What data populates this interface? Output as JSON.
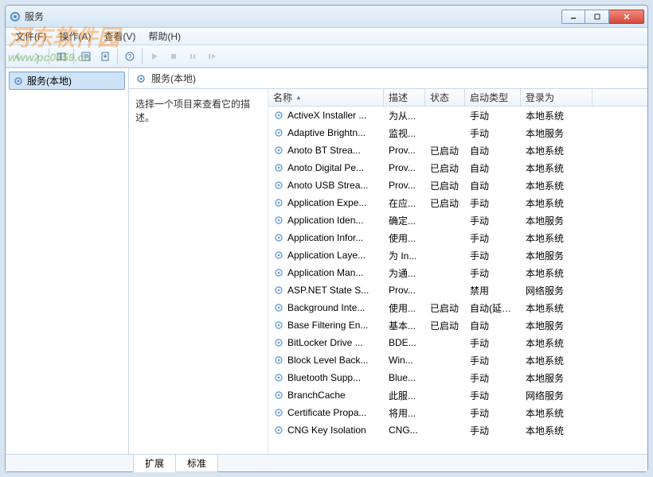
{
  "window": {
    "title": "服务"
  },
  "menubar": [
    {
      "label": "文件(F)"
    },
    {
      "label": "操作(A)"
    },
    {
      "label": "查看(V)"
    },
    {
      "label": "帮助(H)"
    }
  ],
  "tree": {
    "root": "服务(本地)"
  },
  "main_header": "服务(本地)",
  "desc_prompt": "选择一个项目来查看它的描述。",
  "columns": {
    "name": "名称",
    "desc": "描述",
    "status": "状态",
    "startup": "启动类型",
    "logon": "登录为"
  },
  "services": [
    {
      "name": "ActiveX Installer ...",
      "desc": "为从...",
      "status": "",
      "startup": "手动",
      "logon": "本地系统"
    },
    {
      "name": "Adaptive Brightn...",
      "desc": "监视...",
      "status": "",
      "startup": "手动",
      "logon": "本地服务"
    },
    {
      "name": "Anoto BT Strea...",
      "desc": "Prov...",
      "status": "已启动",
      "startup": "自动",
      "logon": "本地系统"
    },
    {
      "name": "Anoto Digital Pe...",
      "desc": "Prov...",
      "status": "已启动",
      "startup": "自动",
      "logon": "本地系统"
    },
    {
      "name": "Anoto USB Strea...",
      "desc": "Prov...",
      "status": "已启动",
      "startup": "自动",
      "logon": "本地系统"
    },
    {
      "name": "Application Expe...",
      "desc": "在应...",
      "status": "已启动",
      "startup": "手动",
      "logon": "本地系统"
    },
    {
      "name": "Application Iden...",
      "desc": "确定...",
      "status": "",
      "startup": "手动",
      "logon": "本地服务"
    },
    {
      "name": "Application Infor...",
      "desc": "使用...",
      "status": "",
      "startup": "手动",
      "logon": "本地系统"
    },
    {
      "name": "Application Laye...",
      "desc": "为 In...",
      "status": "",
      "startup": "手动",
      "logon": "本地服务"
    },
    {
      "name": "Application Man...",
      "desc": "为通...",
      "status": "",
      "startup": "手动",
      "logon": "本地系统"
    },
    {
      "name": "ASP.NET State S...",
      "desc": "Prov...",
      "status": "",
      "startup": "禁用",
      "logon": "网络服务"
    },
    {
      "name": "Background Inte...",
      "desc": "使用...",
      "status": "已启动",
      "startup": "自动(延迟...",
      "logon": "本地系统"
    },
    {
      "name": "Base Filtering En...",
      "desc": "基本...",
      "status": "已启动",
      "startup": "自动",
      "logon": "本地服务"
    },
    {
      "name": "BitLocker Drive ...",
      "desc": "BDE...",
      "status": "",
      "startup": "手动",
      "logon": "本地系统"
    },
    {
      "name": "Block Level Back...",
      "desc": "Win...",
      "status": "",
      "startup": "手动",
      "logon": "本地系统"
    },
    {
      "name": "Bluetooth Supp...",
      "desc": "Blue...",
      "status": "",
      "startup": "手动",
      "logon": "本地服务"
    },
    {
      "name": "BranchCache",
      "desc": "此服...",
      "status": "",
      "startup": "手动",
      "logon": "网络服务"
    },
    {
      "name": "Certificate Propa...",
      "desc": "将用...",
      "status": "",
      "startup": "手动",
      "logon": "本地系统"
    },
    {
      "name": "CNG Key Isolation",
      "desc": "CNG...",
      "status": "",
      "startup": "手动",
      "logon": "本地系统"
    }
  ],
  "tabs": {
    "extended": "扩展",
    "standard": "标准"
  },
  "watermark": {
    "brand": "河东软件园",
    "url": "www.pc0359.cn"
  }
}
